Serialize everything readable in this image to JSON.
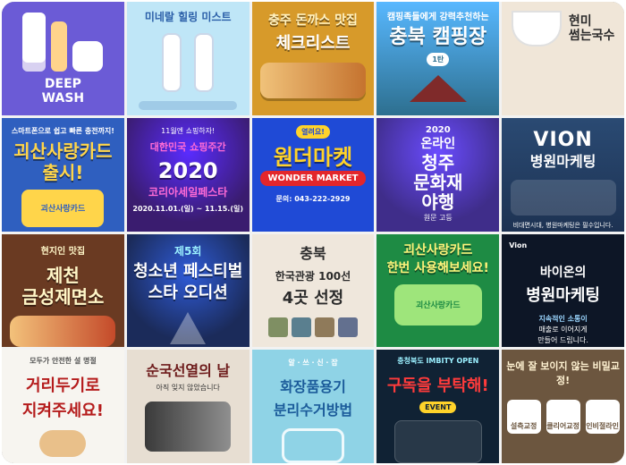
{
  "tiles": [
    {
      "id": "deep-wash",
      "lines": [
        "DEEP",
        "WASH"
      ],
      "bg": "#6b5bd6",
      "accent": "#ffffff"
    },
    {
      "id": "mist",
      "title": "미네랄 힐링 미스트",
      "bg": "#bfe6f7",
      "accent": "#2a5ea8"
    },
    {
      "id": "chungju-food",
      "title1": "충주 돈까스 맛집",
      "title2": "체크리스트",
      "bg": "#d79a2a",
      "accent": "#fff2c2"
    },
    {
      "id": "camping",
      "title1": "캠핑족들에게 강력추천하는",
      "title2": "충북 캠핑장",
      "sub": "1탄",
      "bg": "#2d6f8f",
      "accent": "#ffffff"
    },
    {
      "id": "brown-rice",
      "title1": "현미",
      "title2": "썸는국수",
      "bg": "#f0e6d8",
      "accent": "#2b2b2b"
    },
    {
      "id": "goesan-card-1",
      "title1": "괴산사랑카드",
      "title2": "출시!",
      "sub": "스마트폰으로 쉽고 빠른 충전까지!",
      "card_text": "괴산사랑카드",
      "bg": "#2f5fbf",
      "accent": "#ffd54a"
    },
    {
      "id": "korea-sale",
      "title1": "11월엔 쇼핑하자!",
      "title2": "대한민국 쇼핑주간",
      "title3": "2020",
      "title4": "코리아세일페스타",
      "date": "2020.11.01.(일) ~ 11.15.(일)",
      "bg": "#3a1c6f",
      "accent": "#ff6bd5"
    },
    {
      "id": "wonder-market",
      "title1": "열려요!",
      "title2": "원더마켓",
      "title3": "WONDER MARKET",
      "sub": "문의: 043-222-2929",
      "bg": "#1f4ad6",
      "accent": "#ffd32a"
    },
    {
      "id": "online-heritage",
      "title1": "2020",
      "title2": "온라인",
      "title3": "청주",
      "title4": "문화재",
      "title5": "야행",
      "sub": "원문 고등",
      "bg": "#3f2d8a",
      "accent": "#ffffff"
    },
    {
      "id": "vion",
      "title1": "VION",
      "title2": "병원마케팅",
      "sub": "비대면시대, 병원마케팅은 필수입니다.",
      "bg": "#1d3252",
      "accent": "#ffffff"
    },
    {
      "id": "jecheon-food",
      "title1": "현지인",
      "title2": "맛집",
      "title3": "제천",
      "title4": "금성제면소",
      "bg": "#6a3a22",
      "accent": "#fff6c7"
    },
    {
      "id": "youth-festival",
      "title1": "제5회",
      "title2": "청소년 페스티벌",
      "title3": "스타 오디션",
      "bg": "#1b2b5a",
      "accent": "#9bf0ff"
    },
    {
      "id": "chungbuk-tour",
      "title1": "충북",
      "title2": "한국관광 100선",
      "title3": "4곳 선정",
      "bg": "#efe7dc",
      "accent": "#2b2b2b"
    },
    {
      "id": "goesan-card-2",
      "title1": "괴산사랑카드",
      "title2": "한번 사용해보세요!",
      "card_text": "괴산사랑카드",
      "bg": "#1e8b44",
      "accent": "#fff37a"
    },
    {
      "id": "hospital-marketing",
      "title1": "Vion",
      "title2": "바이온의",
      "title3": "병원마케팅",
      "sub": "지속적인 소통이",
      "sub2": "매출로 이어지게",
      "sub3": "만들어 드립니다.",
      "bg": "#0d1626",
      "accent": "#ffffff"
    },
    {
      "id": "distance",
      "title1": "모두가 안전한 설 명절",
      "title2": "거리두기로",
      "title3": "지켜주세요!",
      "bg": "#f7f5f0",
      "accent": "#b51c1c"
    },
    {
      "id": "patriots-day",
      "title1": "순국선열의 날",
      "title2": "아직 잊지 않았습니다",
      "bg": "#e7ded2",
      "accent": "#6d1b1b"
    },
    {
      "id": "cosmetics",
      "title1": "알 · 쓰 · 신 · 잡",
      "title2": "화장품용기",
      "title3": "분리수거방법",
      "bg": "#8fd3e6",
      "accent": "#1b5b9a"
    },
    {
      "id": "subscribe",
      "title1": "충청북도 IMBITY OPEN",
      "title2": "구독을 부탁해!",
      "title3": "EVENT",
      "bg": "#102234",
      "accent": "#ff3b3b"
    },
    {
      "id": "braces",
      "title1": "눈에 잘 보이지 않는 비밀교정!",
      "opt1": "설측교정",
      "opt2": "클리어교정",
      "opt3": "인비절라인",
      "bg": "#6c563f",
      "accent": "#fff2d2"
    }
  ]
}
